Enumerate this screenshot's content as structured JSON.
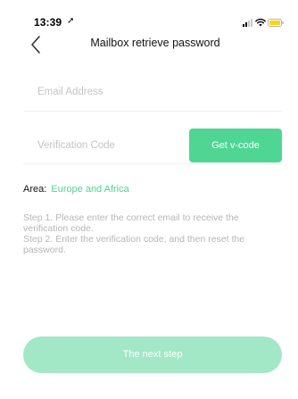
{
  "status_bar": {
    "time": "13:39",
    "location_arrow": "➚",
    "icons": [
      "signal-icon",
      "wifi-icon",
      "battery-icon"
    ]
  },
  "header": {
    "title": "Mailbox retrieve password",
    "back_icon": "chevron-left-icon"
  },
  "form": {
    "email_placeholder": "Email Address",
    "email_value": "",
    "code_placeholder": "Verification Code",
    "code_value": "",
    "get_code_label": "Get v-code"
  },
  "area": {
    "label": "Area:",
    "value": "Europe and Africa"
  },
  "instructions": {
    "step1": "Step 1. Please enter the correct email to receive the verification code.",
    "step2": "Step 2. Enter the verification code, and then reset the password."
  },
  "actions": {
    "next_label": "The next step"
  },
  "colors": {
    "accent": "#4fd693",
    "accent_disabled": "#a2e8c6",
    "placeholder": "#c4c4c4",
    "instruction_text": "#b6b6b6",
    "battery": "#ffd60a"
  }
}
